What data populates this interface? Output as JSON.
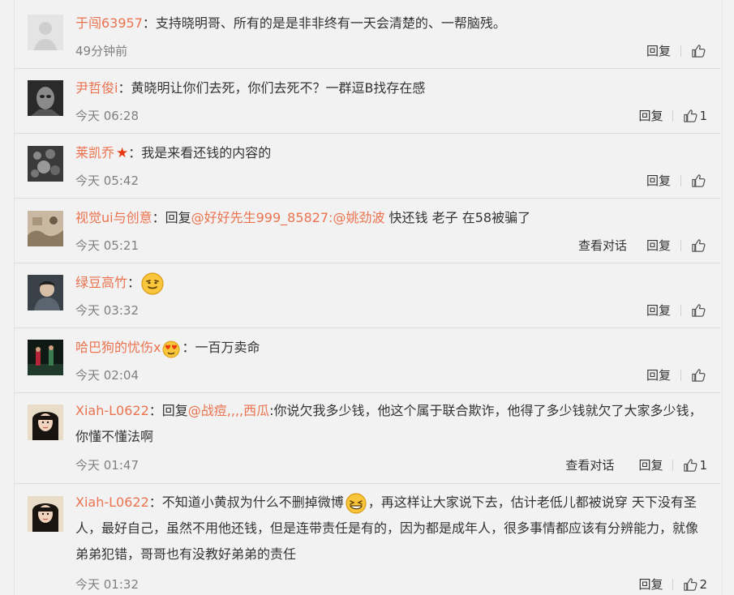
{
  "colors": {
    "username": "#eb7350",
    "text": "#333333",
    "timestamp": "#808080",
    "divider": "#dcdcdc",
    "background": "#f2f2f2"
  },
  "actions": {
    "reply": "回复",
    "view_conversation": "查看对话"
  },
  "comments": [
    {
      "user": "于闯63957",
      "text": "：支持晓明哥、所有的是是非非终有一天会清楚的、一帮脑残。",
      "time": "49分钟前",
      "likes": ""
    },
    {
      "user": "尹哲俊i",
      "text": "：黄晓明让你们去死，你们去死不？一群逗B找存在感",
      "time": "今天 06:28",
      "likes": "1"
    },
    {
      "user": "莱凯乔",
      "badge": "★",
      "text": "：我是来看还钱的内容的",
      "time": "今天 05:42",
      "likes": ""
    },
    {
      "user": "视觉ui与创意",
      "prefix": "：回复",
      "mention1": "@好好先生999_85827:@姚劲波",
      "text": " 快还钱 老子 在58被骗了",
      "time": "今天 05:21",
      "likes": ""
    },
    {
      "user": "绿豆高竹",
      "text": "：",
      "emoji": "grin-emoji",
      "time": "今天 03:32",
      "likes": ""
    },
    {
      "user": "哈巴狗的忧伤x",
      "emoji": "heart-eyes-emoji",
      "text": "：一百万卖命",
      "time": "今天 02:04",
      "likes": ""
    },
    {
      "user": "Xiah-L0622",
      "prefix": "：回复",
      "mention1": "@战痘,,,,西瓜",
      "text": ":你说欠我多少钱，他这个属于联合欺诈，他得了多少钱就欠了大家多少钱，你懂不懂法啊",
      "time": "今天 01:47",
      "likes": "1"
    },
    {
      "user": "Xiah-L0622",
      "text": "：不知道小黄叔为什么不删掉微博",
      "text2": "，再这样让大家说下去，估计老低儿都被说穿 天下没有圣人，最好自己，虽然不用他还钱，但是连带责任是有的，因为都是成年人，很多事情都应该有分辨能力，就像弟弟犯错，哥哥也有没教好弟弟的责任",
      "emoji": "laugh-emoji",
      "time": "今天 01:32",
      "likes": "2"
    }
  ]
}
